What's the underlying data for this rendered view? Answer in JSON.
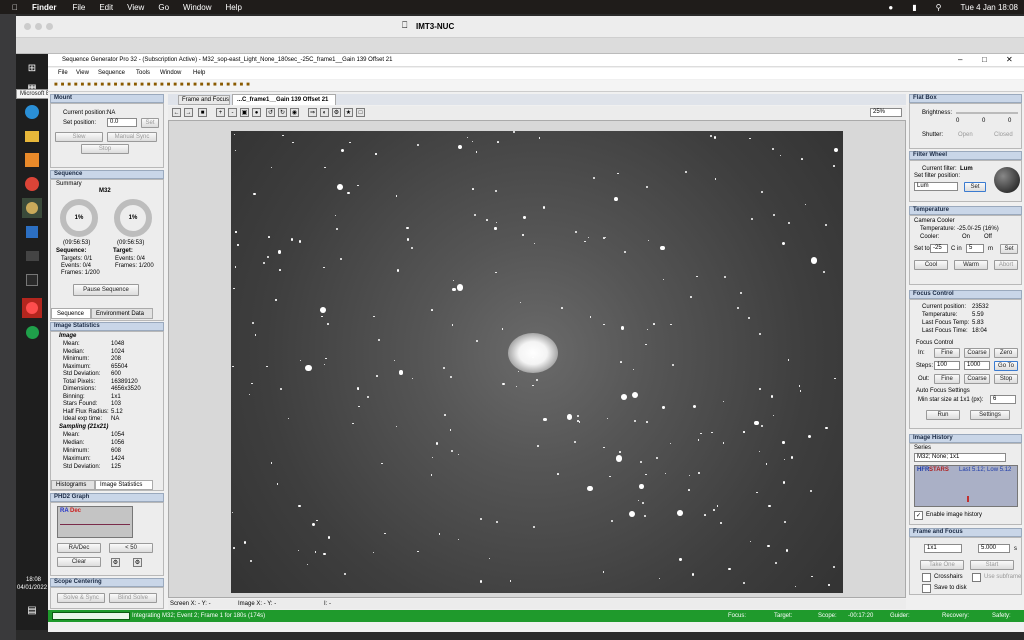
{
  "macbar": {
    "app": "Finder",
    "menus": [
      "File",
      "Edit",
      "View",
      "Go",
      "Window",
      "Help"
    ],
    "clock": "Tue 4 Jan  18:08"
  },
  "host": {
    "name": "IMT3-NUC"
  },
  "taskbar": {
    "tooltip": "Microsoft Edge",
    "time": "18:08",
    "date": "04/01/2022"
  },
  "app": {
    "title": "Sequence Generator Pro 32 - (Subscription Active) - M32_sop-east_Light_None_180sec_-25C_frame1__Gain 139 Offset 21",
    "menus": [
      "File",
      "View",
      "Sequence",
      "Tools",
      "Window",
      "Help"
    ]
  },
  "mount": {
    "header": "Mount",
    "cur_pos_label": "Current position:",
    "cur_pos": "NA",
    "set_pos_label": "Set position:",
    "set_pos": "0.0",
    "set_btn": "Set",
    "slew_btn": "Slew",
    "manual_sync": "Manual Sync",
    "stop": "Stop"
  },
  "sequence": {
    "header": "Sequence",
    "summary": "Summary",
    "target": "M32",
    "pct1": "1%",
    "pct2": "1%",
    "time1": "(09:56:53)",
    "time2": "(09:56:53)",
    "seq_label": "Sequence:",
    "tgt_label": "Target:",
    "targets": "Targets:  0/1",
    "events1": "Events:    0/4",
    "frames1": "Frames:  1/200",
    "events2": "Events:    0/4",
    "frames2": "Frames:  1/200",
    "pause": "Pause Sequence",
    "tab1": "Sequence",
    "tab2": "Environment Data"
  },
  "imgstats": {
    "header": "Image Statistics",
    "image_label": "Image",
    "rows": [
      [
        "Mean:",
        "1048"
      ],
      [
        "Median:",
        "1024"
      ],
      [
        "Minimum:",
        "208"
      ],
      [
        "Maximum:",
        "65504"
      ],
      [
        "Std Deviation:",
        "600"
      ],
      [
        "Total Pixels:",
        "16389120"
      ],
      [
        "Dimensions:",
        "4656x3520"
      ],
      [
        "Binning:",
        "1x1"
      ],
      [
        "Stars Found:",
        "103"
      ],
      [
        "Half Flux Radius:",
        "5.12"
      ],
      [
        "Ideal exp time:",
        "NA"
      ]
    ],
    "sampling_label": "Sampling (21x21)",
    "srows": [
      [
        "Mean:",
        "1054"
      ],
      [
        "Median:",
        "1056"
      ],
      [
        "Minimum:",
        "608"
      ],
      [
        "Maximum:",
        "1424"
      ],
      [
        "Std Deviation:",
        "125"
      ]
    ],
    "tab1": "Histograms",
    "tab2": "Image Statistics"
  },
  "phd2": {
    "header": "PHD2 Graph",
    "ra": "RA",
    "dec": "Dec",
    "radec_btn": "RA/Dec",
    "range": "< 50",
    "clear": "Clear"
  },
  "scope": {
    "header": "Scope Centering",
    "solve_sync": "Solve & Sync",
    "blind_solve": "Blind Solve"
  },
  "tabs": {
    "t1": "Frame and Focus",
    "t2": "...C_frame1__Gain 139 Offset 21"
  },
  "zoom": "25%",
  "imgfooter": {
    "screen": "Screen X: - Y: -",
    "image": "Image X: - Y: -",
    "i": "I: -"
  },
  "flatbox": {
    "header": "Flat Box",
    "brightness": "Brightness:",
    "v1": "0",
    "v2": "0",
    "v3": "0",
    "shutter": "Shutter:",
    "open": "Open",
    "closed": "Closed"
  },
  "filter": {
    "header": "Filter Wheel",
    "cur_label": "Current filter:",
    "cur": "Lum",
    "set_label": "Set filter position:",
    "sel": "Lum",
    "set": "Set"
  },
  "temp": {
    "header": "Temperature",
    "cooler_label": "Camera Cooler",
    "temp_line": "Temperature: -25.0/-25 (16%)",
    "cooler": "Cooler:",
    "on": "On",
    "off": "Off",
    "setto": "Set to",
    "v1": "-25",
    "cin": "C in",
    "v2": "5",
    "m": "m",
    "set": "Set",
    "cool": "Cool",
    "warm": "Warm",
    "abort": "Abort"
  },
  "focus": {
    "header": "Focus Control",
    "rows": [
      [
        "Current position:",
        "23532"
      ],
      [
        "Temperature:",
        "5.59"
      ],
      [
        "Last Focus Temp:",
        "5.83"
      ],
      [
        "Last Focus Time:",
        "18:04"
      ]
    ],
    "fc_label": "Focus Control",
    "in": "In:",
    "out": "Out:",
    "fine": "Fine",
    "coarse": "Coarse",
    "zero": "Zero",
    "steps": "Steps:",
    "s1": "100",
    "s2": "1000",
    "goto": "Go To",
    "stop": "Stop",
    "af_label": "Auto Focus Settings",
    "minstar": "Min star size at 1x1 (px):",
    "minstar_v": "6",
    "run": "Run",
    "settings": "Settings"
  },
  "history": {
    "header": "Image History",
    "series": "Series",
    "sel": "M32; None; 1x1",
    "hfr": "HFR",
    "stars": "STARS",
    "last": "Last 5.12; Low 5.12",
    "enable": "Enable image history"
  },
  "ff": {
    "header": "Frame and Focus",
    "bin": "1x1",
    "exp": "5.000",
    "s": "s",
    "take": "Take One",
    "start": "Start",
    "crosshairs": "Crosshairs",
    "subframe": "Use subframe",
    "save": "Save to disk"
  },
  "status": {
    "msg": "Integrating M32; Event 2; Frame 1 for 180s (174s)",
    "focus": "Focus:",
    "target": "Target:",
    "scope": "Scope:",
    "scope_val": "-00:17:20",
    "guider": "Guider:",
    "recovery": "Recovery:",
    "safety": "Safety:"
  },
  "colors": {
    "status": "#1f9a2c",
    "header": "#c9d6e8"
  }
}
